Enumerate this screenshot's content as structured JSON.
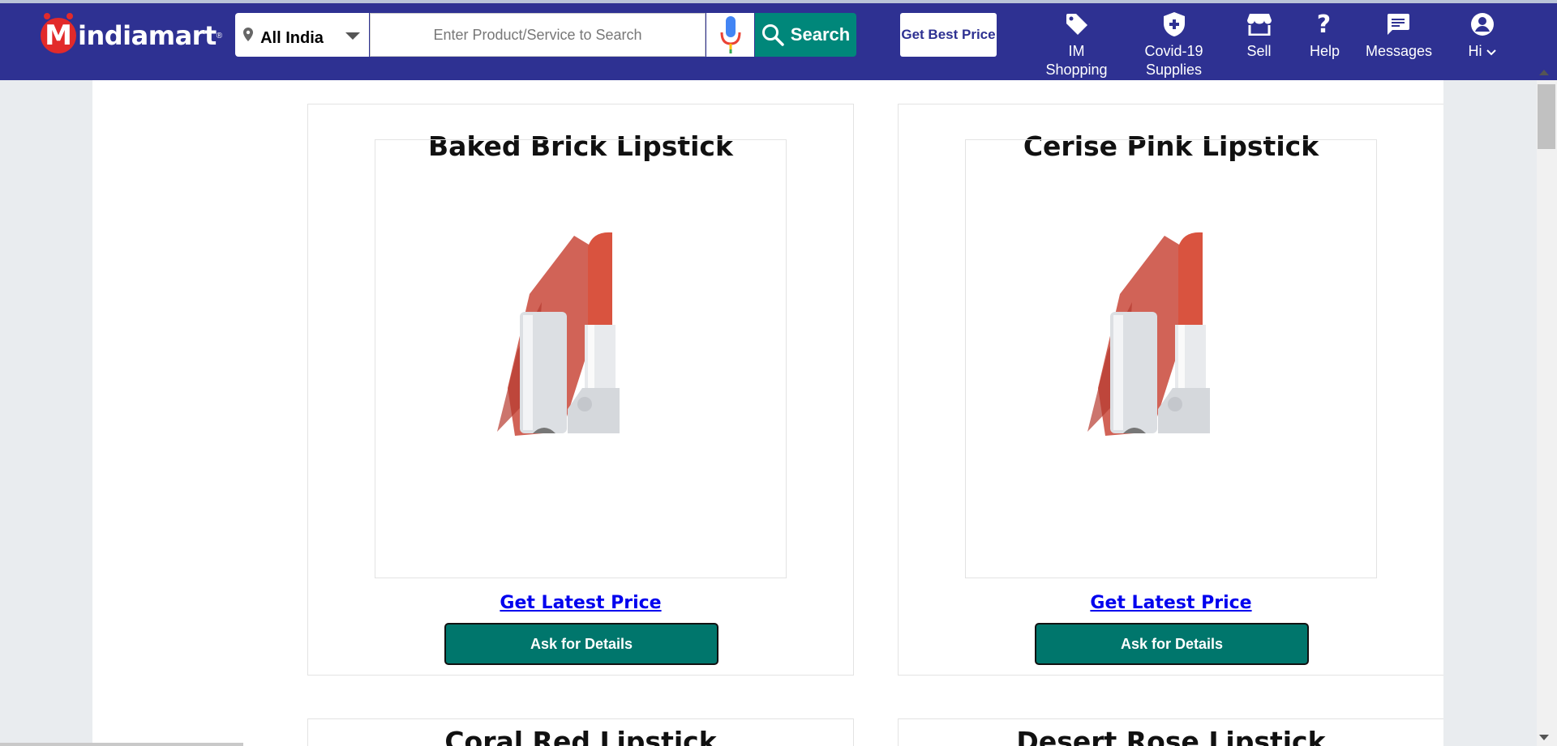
{
  "header": {
    "logo_text": "indiamart",
    "logo_reg": "®",
    "location": "All India",
    "search_placeholder": "Enter Product/Service to Search",
    "search_label": "Search",
    "best_price_label": "Get Best Price",
    "nav": {
      "shopping": "IM Shopping",
      "covid": "Covid-19 Supplies",
      "sell": "Sell",
      "help": "Help",
      "messages": "Messages",
      "profile": "Hi"
    }
  },
  "products": [
    {
      "title": "Baked Brick Lipstick",
      "price_link": "Get Latest Price",
      "button": "Ask for Details"
    },
    {
      "title": "Cerise Pink Lipstick",
      "price_link": "Get Latest Price",
      "button": "Ask for Details"
    },
    {
      "title": "Coral Red Lipstick"
    },
    {
      "title": "Desert Rose Lipstick"
    }
  ],
  "colors": {
    "header_bg": "#2e3192",
    "search_green": "#00877a",
    "button_green": "#00766c",
    "link_blue": "#0000ee",
    "lipstick_red": "#c9483a"
  }
}
